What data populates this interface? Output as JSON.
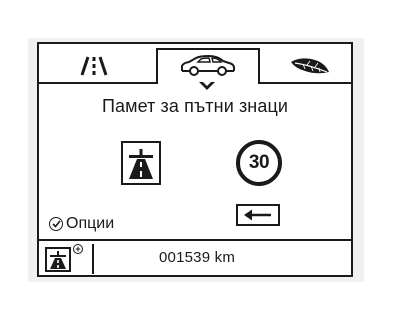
{
  "tabs": {
    "road_icon": "road-view-icon",
    "car_icon": "car-icon",
    "eco_icon": "eco-leaf-icon",
    "active": "car"
  },
  "page": {
    "title": "Памет за пътни знаци"
  },
  "signs": {
    "motorway_icon": "motorway-sign-icon",
    "speed_limit": "30"
  },
  "options": {
    "label": "Опции",
    "icon": "check-circle-icon"
  },
  "back_button": {
    "icon": "arrow-left-icon"
  },
  "status_bar": {
    "icon": "motorway-sign-icon",
    "plus_symbol": "+",
    "odometer": "001539 km"
  }
}
